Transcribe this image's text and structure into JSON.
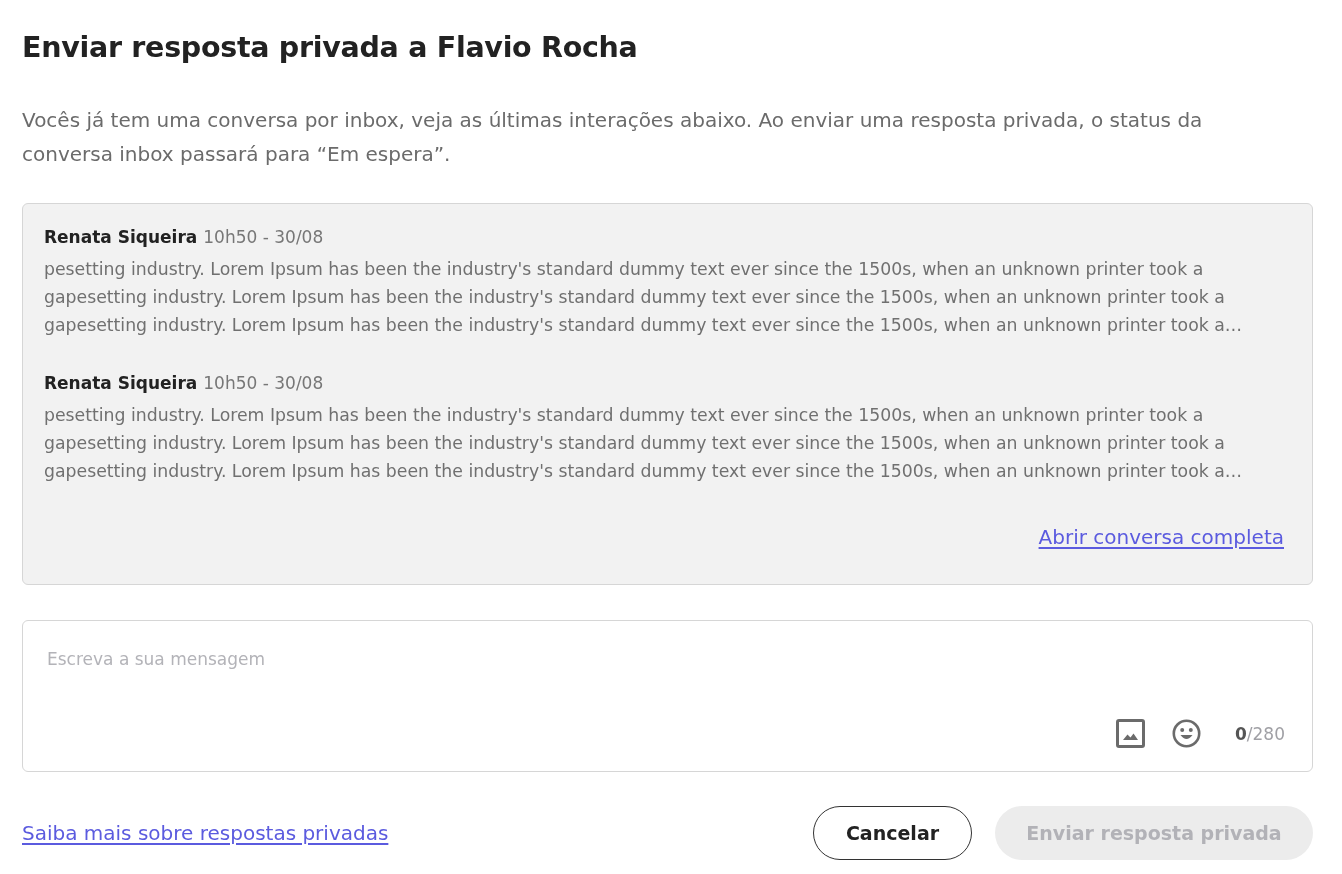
{
  "dialog": {
    "title": "Enviar resposta privada a Flavio Rocha",
    "description": "Vocês já tem uma conversa por inbox, veja as últimas interações abaixo. Ao enviar uma resposta privada, o status da\nconversa inbox passará para “Em espera”."
  },
  "conversation": {
    "messages": [
      {
        "author": "Renata Siqueira",
        "time": "10h50 - 30/08",
        "text": "pesetting industry. Lorem Ipsum has been the industry's standard dummy text ever since the 1500s, when an unknown printer took a\ngapesetting industry. Lorem Ipsum has been the industry's standard dummy text ever since the 1500s, when an unknown printer took a\ngapesetting industry. Lorem Ipsum has been the industry's standard dummy text ever since the 1500s, when an unknown printer took a…"
      },
      {
        "author": "Renata Siqueira",
        "time": "10h50 - 30/08",
        "text": "pesetting industry. Lorem Ipsum has been the industry's standard dummy text ever since the 1500s, when an unknown printer took a\ngapesetting industry. Lorem Ipsum has been the industry's standard dummy text ever since the 1500s, when an unknown printer took a\ngapesetting industry. Lorem Ipsum has been the industry's standard dummy text ever since the 1500s, when an unknown printer took a…"
      }
    ],
    "open_link": "Abrir conversa completa"
  },
  "composer": {
    "placeholder": "Escreva a sua mensagem",
    "counter": "**0**/280"
  },
  "footer": {
    "help_link": "Saiba mais sobre respostas privadas",
    "buttons": [
      {
        "label": "Cancelar",
        "kind": "secondary",
        "disabled": false
      },
      {
        "label": "Enviar resposta privada",
        "kind": "primary",
        "disabled": true
      }
    ]
  }
}
